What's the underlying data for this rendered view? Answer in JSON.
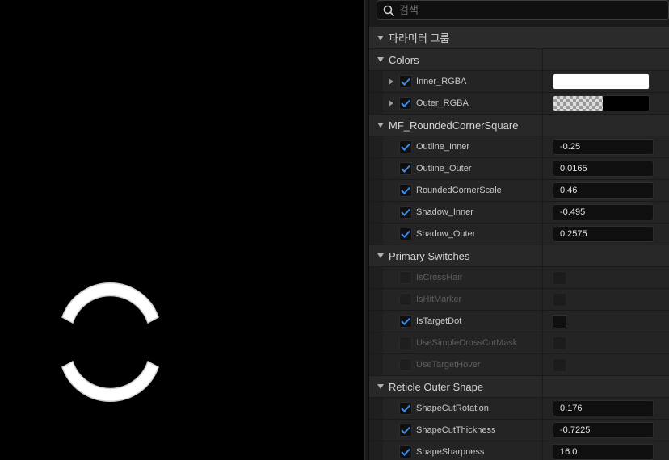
{
  "search": {
    "placeholder": "검색"
  },
  "group_title": "파라미터 그룹",
  "sections": {
    "colors": {
      "label": "Colors",
      "rows": [
        {
          "name": "Inner_RGBA",
          "enabled": true,
          "swatch_color": "#ffffff"
        },
        {
          "name": "Outer_RGBA",
          "enabled": true,
          "swatch_color": "#000000"
        }
      ]
    },
    "rounded": {
      "label": "MF_RoundedCornerSquare",
      "rows": [
        {
          "name": "Outline_Inner",
          "value": "-0.25"
        },
        {
          "name": "Outline_Outer",
          "value": "0.0165"
        },
        {
          "name": "RoundedCornerScale",
          "value": "0.46"
        },
        {
          "name": "Shadow_Inner",
          "value": "-0.495"
        },
        {
          "name": "Shadow_Outer",
          "value": "0.2575"
        }
      ]
    },
    "switches": {
      "label": "Primary Switches",
      "rows": [
        {
          "name": "IsCrossHair",
          "enabled": false
        },
        {
          "name": "IsHitMarker",
          "enabled": false
        },
        {
          "name": "IsTargetDot",
          "enabled": true
        },
        {
          "name": "UseSimpleCrossCutMask",
          "enabled": false
        },
        {
          "name": "UseTargetHover",
          "enabled": false
        }
      ]
    },
    "outer_shape": {
      "label": "Reticle Outer Shape",
      "rows": [
        {
          "name": "ShapeCutRotation",
          "value": "0.176"
        },
        {
          "name": "ShapeCutThickness",
          "value": "-0.7225"
        },
        {
          "name": "ShapeSharpness",
          "value": "16.0"
        }
      ]
    }
  },
  "colors": {
    "panel_bg": "#1a1a1a",
    "check_blue": "#3d8be8",
    "viewport_bg": "#000000"
  }
}
